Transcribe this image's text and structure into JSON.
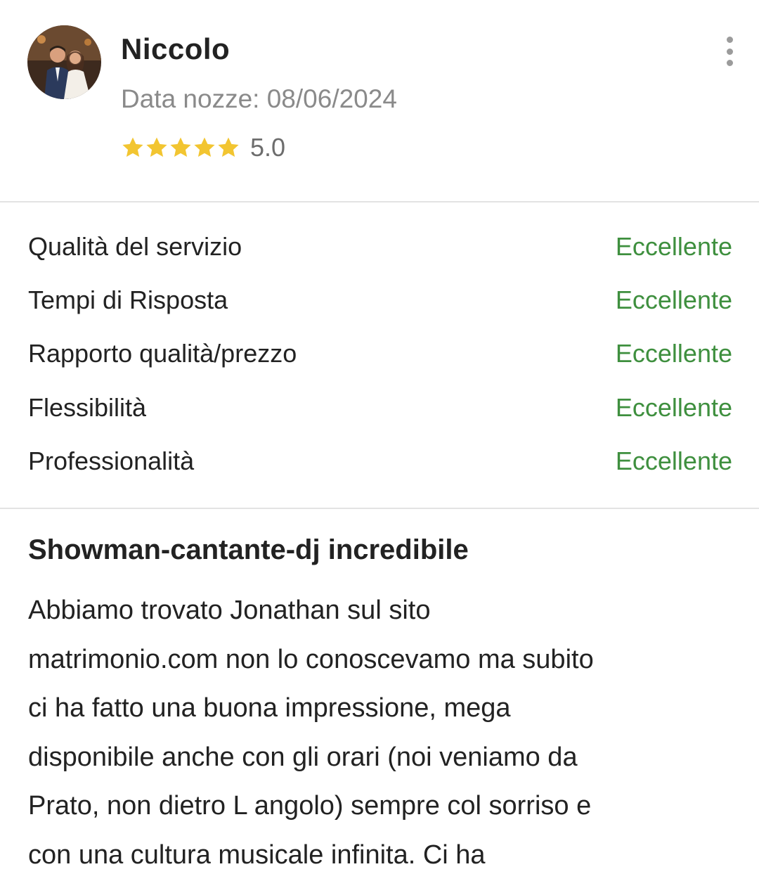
{
  "reviewer": {
    "name": "Niccolo",
    "wedding_date": "Data nozze: 08/06/2024",
    "rating": 5.0,
    "rating_text": "5.0",
    "star_color": "#f2c531"
  },
  "criteria": [
    {
      "label": "Qualità del servizio",
      "value": "Eccellente"
    },
    {
      "label": "Tempi di Risposta",
      "value": "Eccellente"
    },
    {
      "label": "Rapporto qualità/prezzo",
      "value": "Eccellente"
    },
    {
      "label": "Flessibilità",
      "value": "Eccellente"
    },
    {
      "label": "Professionalità",
      "value": "Eccellente"
    }
  ],
  "review": {
    "title": "Showman-cantante-dj incredibile",
    "lines": [
      "Abbiamo trovato Jonathan sul sito",
      "matrimonio.com non lo conoscevamo ma subito",
      "ci ha fatto una buona impressione, mega",
      "disponibile anche con gli orari (noi veniamo da",
      "Prato, non dietro L angolo) sempre col sorriso e",
      "con una cultura musicale infinita. Ci ha"
    ]
  },
  "colors": {
    "accent_green": "#3e8f3e",
    "muted_text": "#8a8a8a",
    "divider": "#e3e3e3"
  },
  "icons": [
    "avatar-photo",
    "star-icon",
    "more-options-icon"
  ]
}
